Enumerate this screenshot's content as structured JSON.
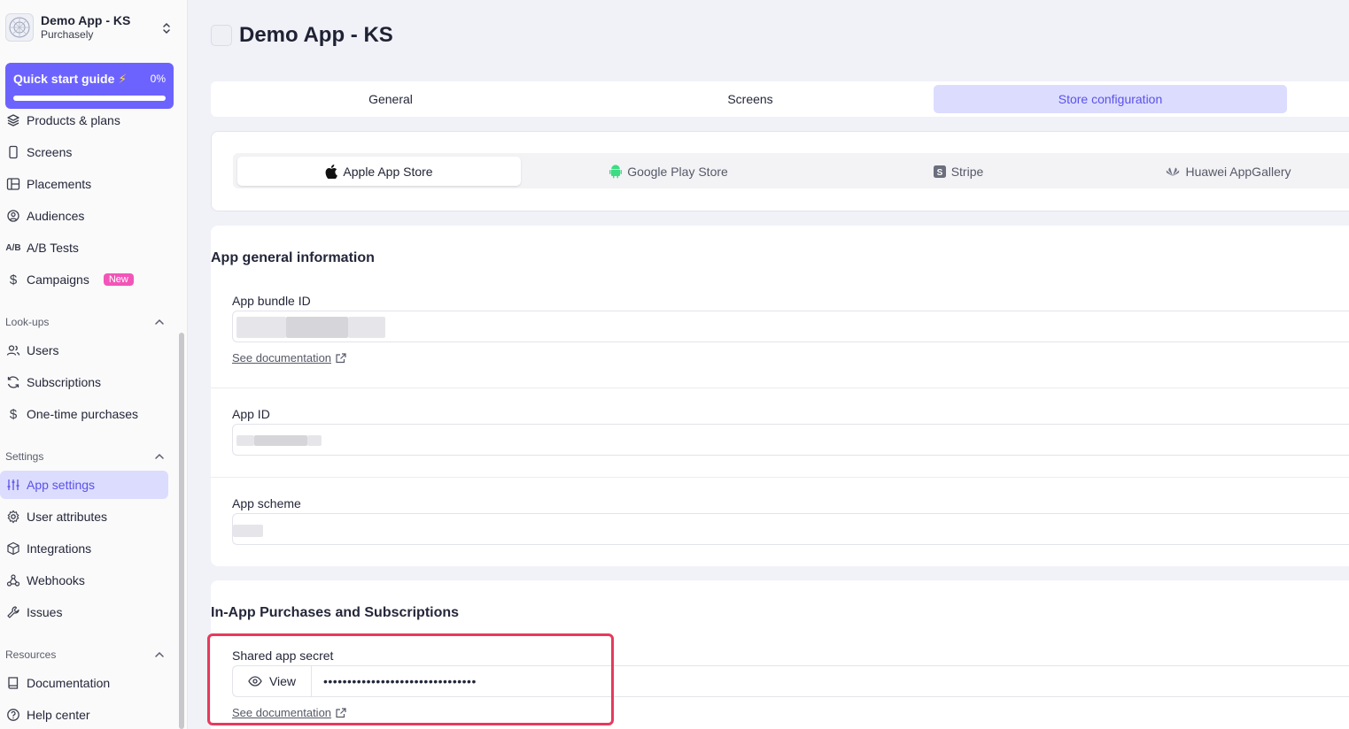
{
  "app": {
    "name": "Demo App - KS",
    "org": "Purchasely"
  },
  "quick_start": {
    "label": "Quick start guide",
    "progress": "0%",
    "progress_fraction": 0
  },
  "sidebar": {
    "items_top": [
      {
        "label": "Products & plans",
        "icon": "layers-icon"
      },
      {
        "label": "Screens",
        "icon": "phone-icon"
      },
      {
        "label": "Placements",
        "icon": "layout-icon"
      },
      {
        "label": "Audiences",
        "icon": "target-icon"
      },
      {
        "label": "A/B Tests",
        "icon": "ab-icon"
      },
      {
        "label": "Campaigns",
        "icon": "dollar-icon",
        "badge": "New"
      }
    ],
    "lookups_title": "Look-ups",
    "lookups": [
      {
        "label": "Users",
        "icon": "users-icon"
      },
      {
        "label": "Subscriptions",
        "icon": "refresh-icon"
      },
      {
        "label": "One-time purchases",
        "icon": "dollar-icon"
      }
    ],
    "settings_title": "Settings",
    "settings": [
      {
        "label": "App settings",
        "icon": "sliders-icon"
      },
      {
        "label": "User attributes",
        "icon": "gear-icon"
      },
      {
        "label": "Integrations",
        "icon": "box-icon"
      },
      {
        "label": "Webhooks",
        "icon": "webhook-icon"
      },
      {
        "label": "Issues",
        "icon": "wrench-icon"
      }
    ],
    "resources_title": "Resources",
    "resources": [
      {
        "label": "Documentation",
        "icon": "book-icon"
      },
      {
        "label": "Help center",
        "icon": "help-icon"
      }
    ]
  },
  "page": {
    "title": "Demo App - KS"
  },
  "tabs": [
    "General",
    "Screens",
    "Store configuration"
  ],
  "stores": [
    "Apple App Store",
    "Google Play Store",
    "Stripe",
    "Huawei AppGallery"
  ],
  "general_info": {
    "title": "App general information",
    "bundle_label": "App bundle ID",
    "doc_link": "See documentation",
    "app_id_label": "App ID",
    "scheme_label": "App scheme"
  },
  "iap": {
    "title": "In-App Purchases and Subscriptions",
    "secret_label": "Shared app secret",
    "view_label": "View",
    "secret_value": "••••••••••••••••••••••••••••••••",
    "doc_link": "See documentation"
  },
  "colors": {
    "accent": "#6c63ff",
    "active_bg": "#dcdcff",
    "highlight": "#e63a5c",
    "badge": "#f255b8"
  }
}
